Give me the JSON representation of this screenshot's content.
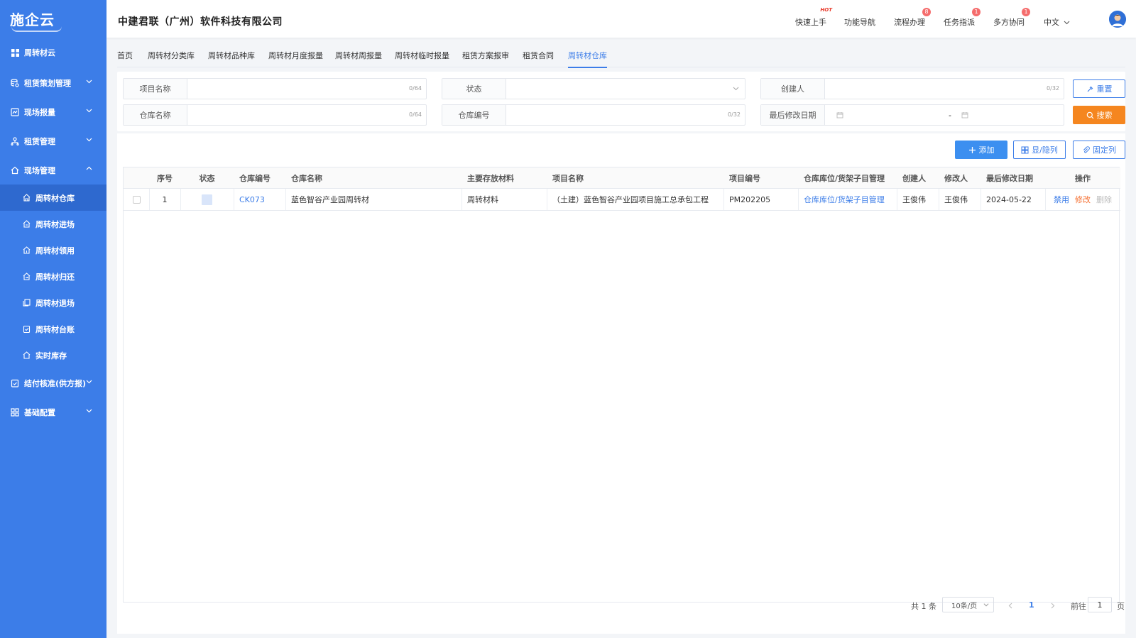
{
  "brand": {
    "logo_text": "施企云"
  },
  "sidebar": {
    "root_label": "周转材云",
    "groups": [
      {
        "label": "租赁策划管理"
      },
      {
        "label": "现场报量"
      },
      {
        "label": "租赁管理"
      },
      {
        "label": "现场管理"
      },
      {
        "label": "结付核准(供方报)"
      },
      {
        "label": "基础配置"
      }
    ],
    "sub_items": [
      {
        "label": "周转材仓库"
      },
      {
        "label": "周转材进场"
      },
      {
        "label": "周转材领用"
      },
      {
        "label": "周转材归还"
      },
      {
        "label": "周转材退场"
      },
      {
        "label": "周转材台账"
      },
      {
        "label": "实时库存"
      }
    ]
  },
  "header": {
    "company": "中建君联（广州）软件科技有限公司",
    "nav": [
      {
        "label": "快速上手",
        "tag": "HOT"
      },
      {
        "label": "功能导航"
      },
      {
        "label": "流程办理",
        "badge": "8"
      },
      {
        "label": "任务指派",
        "badge": "1"
      },
      {
        "label": "多方协同",
        "badge": "1"
      }
    ],
    "language": "中文"
  },
  "tabs": [
    "首页",
    "周转材分类库",
    "周转材品种库",
    "周转材月度报量",
    "周转材周报量",
    "周转材临时报量",
    "租赁方案报审",
    "租赁合同",
    "周转材仓库"
  ],
  "active_tab": "周转材仓库",
  "filters": {
    "project_name": {
      "label": "项目名称",
      "count": "0/64"
    },
    "status": {
      "label": "状态"
    },
    "creator": {
      "label": "创建人",
      "count": "0/32"
    },
    "warehouse_name": {
      "label": "仓库名称",
      "count": "0/64"
    },
    "warehouse_code": {
      "label": "仓库编号",
      "count": "0/32"
    },
    "last_modified": {
      "label": "最后修改日期",
      "separator": "-"
    },
    "reset_label": "重置",
    "search_label": "搜索"
  },
  "toolbar": {
    "add_label": "添加",
    "toggle_cols_label": "显/隐列",
    "fix_cols_label": "固定列"
  },
  "table": {
    "headers": {
      "index": "序号",
      "status": "状态",
      "code": "仓库编号",
      "name": "仓库名称",
      "material": "主要存放材料",
      "project_name": "项目名称",
      "project_code": "项目编号",
      "location": "仓库库位/货架子目管理",
      "creator": "创建人",
      "modifier": "修改人",
      "modified_date": "最后修改日期",
      "actions": "操作"
    },
    "rows": [
      {
        "index": "1",
        "code": "CK073",
        "name": "蓝色智谷产业园周转材",
        "material": "周转材料",
        "project_name": "（土建）蓝色智谷产业园项目施工总承包工程",
        "project_code": "PM202205",
        "location": "仓库库位/货架子目管理",
        "creator": "王俊伟",
        "modifier": "王俊伟",
        "modified_date": "2024-05-22",
        "op_disable": "禁用",
        "op_edit": "修改",
        "op_delete": "删除"
      }
    ]
  },
  "pagination": {
    "total": "共 1 条",
    "page_size": "10条/页",
    "current": "1",
    "goto_prefix": "前往",
    "goto_value": "1",
    "goto_suffix": "页"
  },
  "colors": {
    "sidebar": "#3c7de8",
    "accent": "#3c7de8",
    "search": "#f5861f",
    "badge": "#f56c6c"
  }
}
